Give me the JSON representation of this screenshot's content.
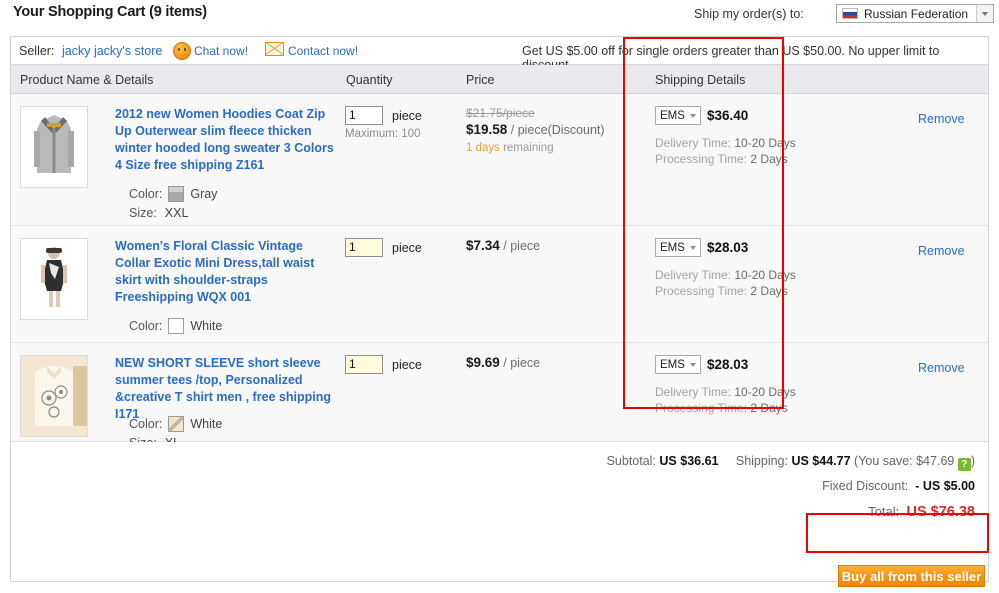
{
  "header": {
    "cart_title": "Your Shopping Cart (9 items)",
    "ship_to_label": "Ship my order(s) to:",
    "country": "Russian Federation"
  },
  "seller_bar": {
    "seller_label": "Seller:",
    "seller_name": "jacky jacky's store",
    "chat_link": "Chat now!",
    "contact_link": "Contact now!",
    "promo": "Get US $5.00 off for single orders greater than US $50.00. No upper limit to discount."
  },
  "columns": {
    "product": "Product Name & Details",
    "quantity": "Quantity",
    "price": "Price",
    "shipping": "Shipping Details",
    "action": ""
  },
  "items": [
    {
      "title": "2012 new Women Hoodies Coat Zip Up Outerwear slim fleece thicken winter hooded long sweater 3 Colors 4 Size free shipping Z161",
      "color_label": "Color:",
      "color_value": "Gray",
      "size_label": "Size:",
      "size_value": "XXL",
      "qty": "1",
      "qty_unit": "piece",
      "qty_max": "Maximum: 100",
      "price_old": "$21.75/piece",
      "price_new": "$19.58",
      "price_unit": "/ piece(Discount)",
      "price_days_hl": "1 days",
      "price_days_rest": " remaining",
      "ship_method": "EMS",
      "ship_cost": "$36.40",
      "delivery_label": "Delivery Time:",
      "delivery_value": "10-20 Days",
      "processing_label": "Processing Time:",
      "processing_value": "2 Days",
      "remove": "Remove"
    },
    {
      "title": "Women's Floral Classic Vintage Collar Exotic Mini Dress,tall waist skirt with shoulder-straps Freeshipping WQX 001",
      "color_label": "Color:",
      "color_value": "White",
      "size_label": "",
      "size_value": "",
      "qty": "1",
      "qty_unit": "piece",
      "qty_max": "",
      "price_old": "",
      "price_new": "$7.34",
      "price_unit": "/ piece",
      "price_days_hl": "",
      "price_days_rest": "",
      "ship_method": "EMS",
      "ship_cost": "$28.03",
      "delivery_label": "Delivery Time:",
      "delivery_value": "10-20 Days",
      "processing_label": "Processing Time:",
      "processing_value": "2 Days",
      "remove": "Remove"
    },
    {
      "title": "NEW SHORT SLEEVE short sleeve summer tees /top, Personalized &creative T shirt men , free shipping I171",
      "color_label": "Color:",
      "color_value": "White",
      "size_label": "Size:",
      "size_value": "XL",
      "qty": "1",
      "qty_unit": "piece",
      "qty_max": "",
      "price_old": "",
      "price_new": "$9.69",
      "price_unit": "/ piece",
      "price_days_hl": "",
      "price_days_rest": "",
      "ship_method": "EMS",
      "ship_cost": "$28.03",
      "delivery_label": "Delivery Time:",
      "delivery_value": "10-20 Days",
      "processing_label": "Processing Time:",
      "processing_value": "2 Days",
      "remove": "Remove"
    }
  ],
  "totals": {
    "subtotal_label": "Subtotal:",
    "subtotal_value": "US $36.61",
    "shipping_label": "Shipping:",
    "shipping_value": "US $44.77",
    "save_text": "(You save: $47.69",
    "save_icon": "?",
    "save_close": ")",
    "fixed_label": "Fixed Discount:",
    "fixed_value": "- US $5.00",
    "total_label": "Total:",
    "total_value": "US $76.38"
  },
  "buy_button": "Buy all from this seller"
}
